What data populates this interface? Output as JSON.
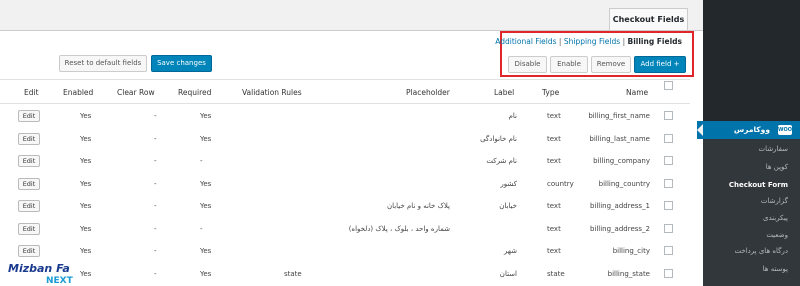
{
  "tab": {
    "label": "Checkout Fields"
  },
  "sublinks": {
    "additional": "Additional Fields",
    "shipping": "Shipping Fields",
    "billing": "Billing Fields",
    "sep": "|"
  },
  "toolbar": {
    "reset": "Reset to default fields",
    "save": "Save changes",
    "disable": "Disable",
    "enable": "Enable",
    "remove": "Remove",
    "add": "Add field +"
  },
  "headers": {
    "edit": "Edit",
    "enabled": "Enabled",
    "clear_row": "Clear Row",
    "required": "Required",
    "validation": "Validation Rules",
    "placeholder": "Placeholder",
    "label": "Label",
    "type": "Type",
    "name": "Name"
  },
  "rows": [
    {
      "edit": "Edit",
      "enabled": "Yes",
      "clear": "-",
      "required": "Yes",
      "validation": "",
      "placeholder": "",
      "label": "نام",
      "type": "text",
      "name": "billing_first_name"
    },
    {
      "edit": "Edit",
      "enabled": "Yes",
      "clear": "-",
      "required": "Yes",
      "validation": "",
      "placeholder": "",
      "label": "نام خانوادگی",
      "type": "text",
      "name": "billing_last_name"
    },
    {
      "edit": "Edit",
      "enabled": "Yes",
      "clear": "-",
      "required": "-",
      "validation": "",
      "placeholder": "",
      "label": "نام شرکت",
      "type": "text",
      "name": "billing_company"
    },
    {
      "edit": "Edit",
      "enabled": "Yes",
      "clear": "-",
      "required": "Yes",
      "validation": "",
      "placeholder": "",
      "label": "کشور",
      "type": "country",
      "name": "billing_country"
    },
    {
      "edit": "Edit",
      "enabled": "Yes",
      "clear": "-",
      "required": "Yes",
      "validation": "",
      "placeholder": "پلاک خانه و نام خیابان",
      "label": "خیابان",
      "type": "text",
      "name": "billing_address_1"
    },
    {
      "edit": "Edit",
      "enabled": "Yes",
      "clear": "-",
      "required": "-",
      "validation": "",
      "placeholder": "شماره واحد ، بلوک ، پلاک (دلخواه)",
      "label": "",
      "type": "text",
      "name": "billing_address_2"
    },
    {
      "edit": "Edit",
      "enabled": "Yes",
      "clear": "-",
      "required": "Yes",
      "validation": "",
      "placeholder": "",
      "label": "شهر",
      "type": "text",
      "name": "billing_city"
    },
    {
      "edit": "",
      "enabled": "Yes",
      "clear": "-",
      "required": "Yes",
      "validation": "state",
      "placeholder": "",
      "label": "استان",
      "type": "state",
      "name": "billing_state"
    }
  ],
  "sidebar": {
    "active": "ووکامرس",
    "woo_badge": "WOO",
    "sub": [
      "سفارشات",
      "کوپن ها",
      "Checkout Form",
      "گزارشات",
      "پیکربندی",
      "وضعیت",
      "درگاه های پرداخت",
      "پوسته ها"
    ]
  },
  "logo": {
    "line1": "Mizban Fa",
    "line2": "NEXT"
  },
  "colors": {
    "accent": "#0073aa",
    "primary_button": "#0085ba",
    "highlight_box": "#e0262b",
    "sidebar": "#23282d"
  }
}
